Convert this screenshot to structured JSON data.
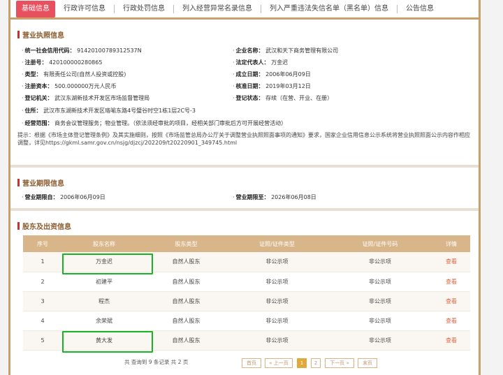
{
  "tabs": [
    "基础信息",
    "行政许可信息",
    "行政处罚信息",
    "列入经营异常名录信息",
    "列入严重违法失信名单（黑名单）信息",
    "公告信息"
  ],
  "license": {
    "title": "营业执照信息",
    "credit_code_label": "统一社会信用代码：",
    "credit_code": "91420100789312537N",
    "company_name_label": "企业名称：",
    "company_name": "武汉和天下商务管理有限公司",
    "reg_no_label": "注册号：",
    "reg_no": "420100000280865",
    "legal_rep_label": "法定代表人：",
    "legal_rep": "万金迟",
    "type_label": "类型：",
    "type": "有限责任公司(自然人投资或控股)",
    "est_date_label": "成立日期：",
    "est_date": "2006年06月09日",
    "capital_label": "注册资本：",
    "capital": "500.000000万元人民币",
    "approve_date_label": "核准日期：",
    "approve_date": "2019年03月12日",
    "authority_label": "登记机关：",
    "authority": "武汉东湖新技术开发区市场监督管理局",
    "status_label": "登记状态：",
    "status": "存续（在营、开业、在册）",
    "address_label": "住所：",
    "address": "武汉市东湖新技术开发区珞喻东路4号璧谷时空1栋1层2C号-3",
    "scope_label": "经营范围：",
    "scope": "商务会议管理服务；物业管理。（依法须经审批的项目，经相关部门审批后方可开展经营活动）",
    "note": "提示：根据《市场主体登记管理条例》及其实施细则，按照《市场监管总局办公厅关于调整营业执照照面事项的通知》要求，国家企业信用信息公示系统将营业执照照面公示内容作相应调整，详见https://gkml.samr.gov.cn/nsjg/djzcj/202209/t20220901_349745.html"
  },
  "period": {
    "title": "营业期限信息",
    "from_label": "营业期限自：",
    "from": "2006年06月09日",
    "to_label": "营业期限至：",
    "to": "2026年06月08日"
  },
  "shareholders": {
    "title": "股东及出资信息",
    "headers": [
      "序号",
      "股东名称",
      "股东类型",
      "证照/证件类型",
      "证照/证件号码",
      "详情"
    ],
    "rows": [
      [
        "1",
        "万金迟",
        "自然人股东",
        "非公示项",
        "非公示项",
        "查看"
      ],
      [
        "2",
        "初建平",
        "自然人股东",
        "非公示项",
        "非公示项",
        "查看"
      ],
      [
        "3",
        "程杰",
        "自然人股东",
        "非公示项",
        "非公示项",
        "查看"
      ],
      [
        "4",
        "余荣斌",
        "自然人股东",
        "非公示项",
        "非公示项",
        "查看"
      ],
      [
        "5",
        "黄大发",
        "自然人股东",
        "非公示项",
        "非公示项",
        "查看"
      ]
    ],
    "summary": "共 查询到 9 条记录 共 2 页",
    "pager": [
      "首页",
      "« 上一页",
      "1",
      "2",
      "下一页 »",
      "末页"
    ]
  }
}
